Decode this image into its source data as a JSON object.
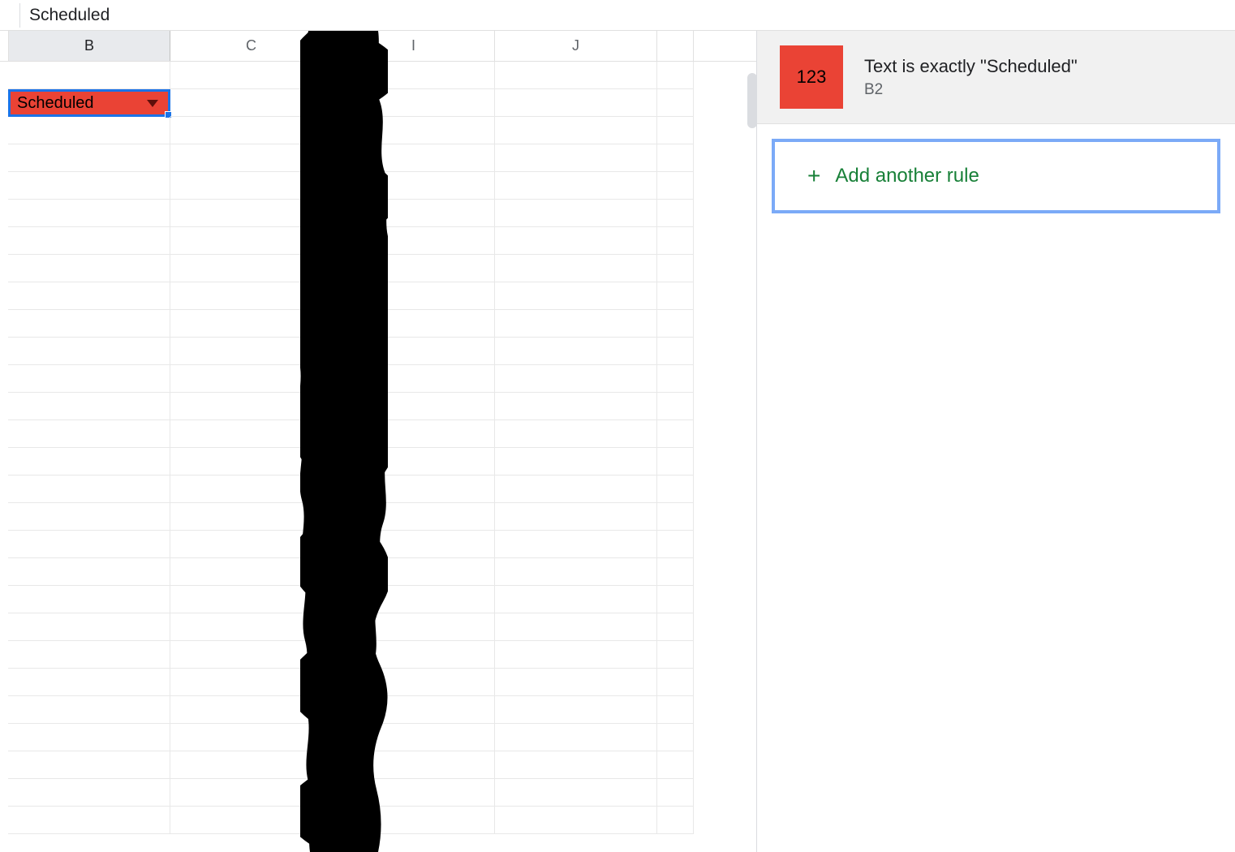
{
  "formula_bar": {
    "value": "Scheduled"
  },
  "columns": [
    "B",
    "C",
    "I",
    "J"
  ],
  "selected_cell": {
    "value": "Scheduled",
    "address": "B2"
  },
  "side_panel": {
    "rule": {
      "swatch_text": "123",
      "swatch_color": "#ea4335",
      "title": "Text is exactly \"Scheduled\"",
      "range": "B2"
    },
    "add_rule_label": "Add another rule"
  }
}
